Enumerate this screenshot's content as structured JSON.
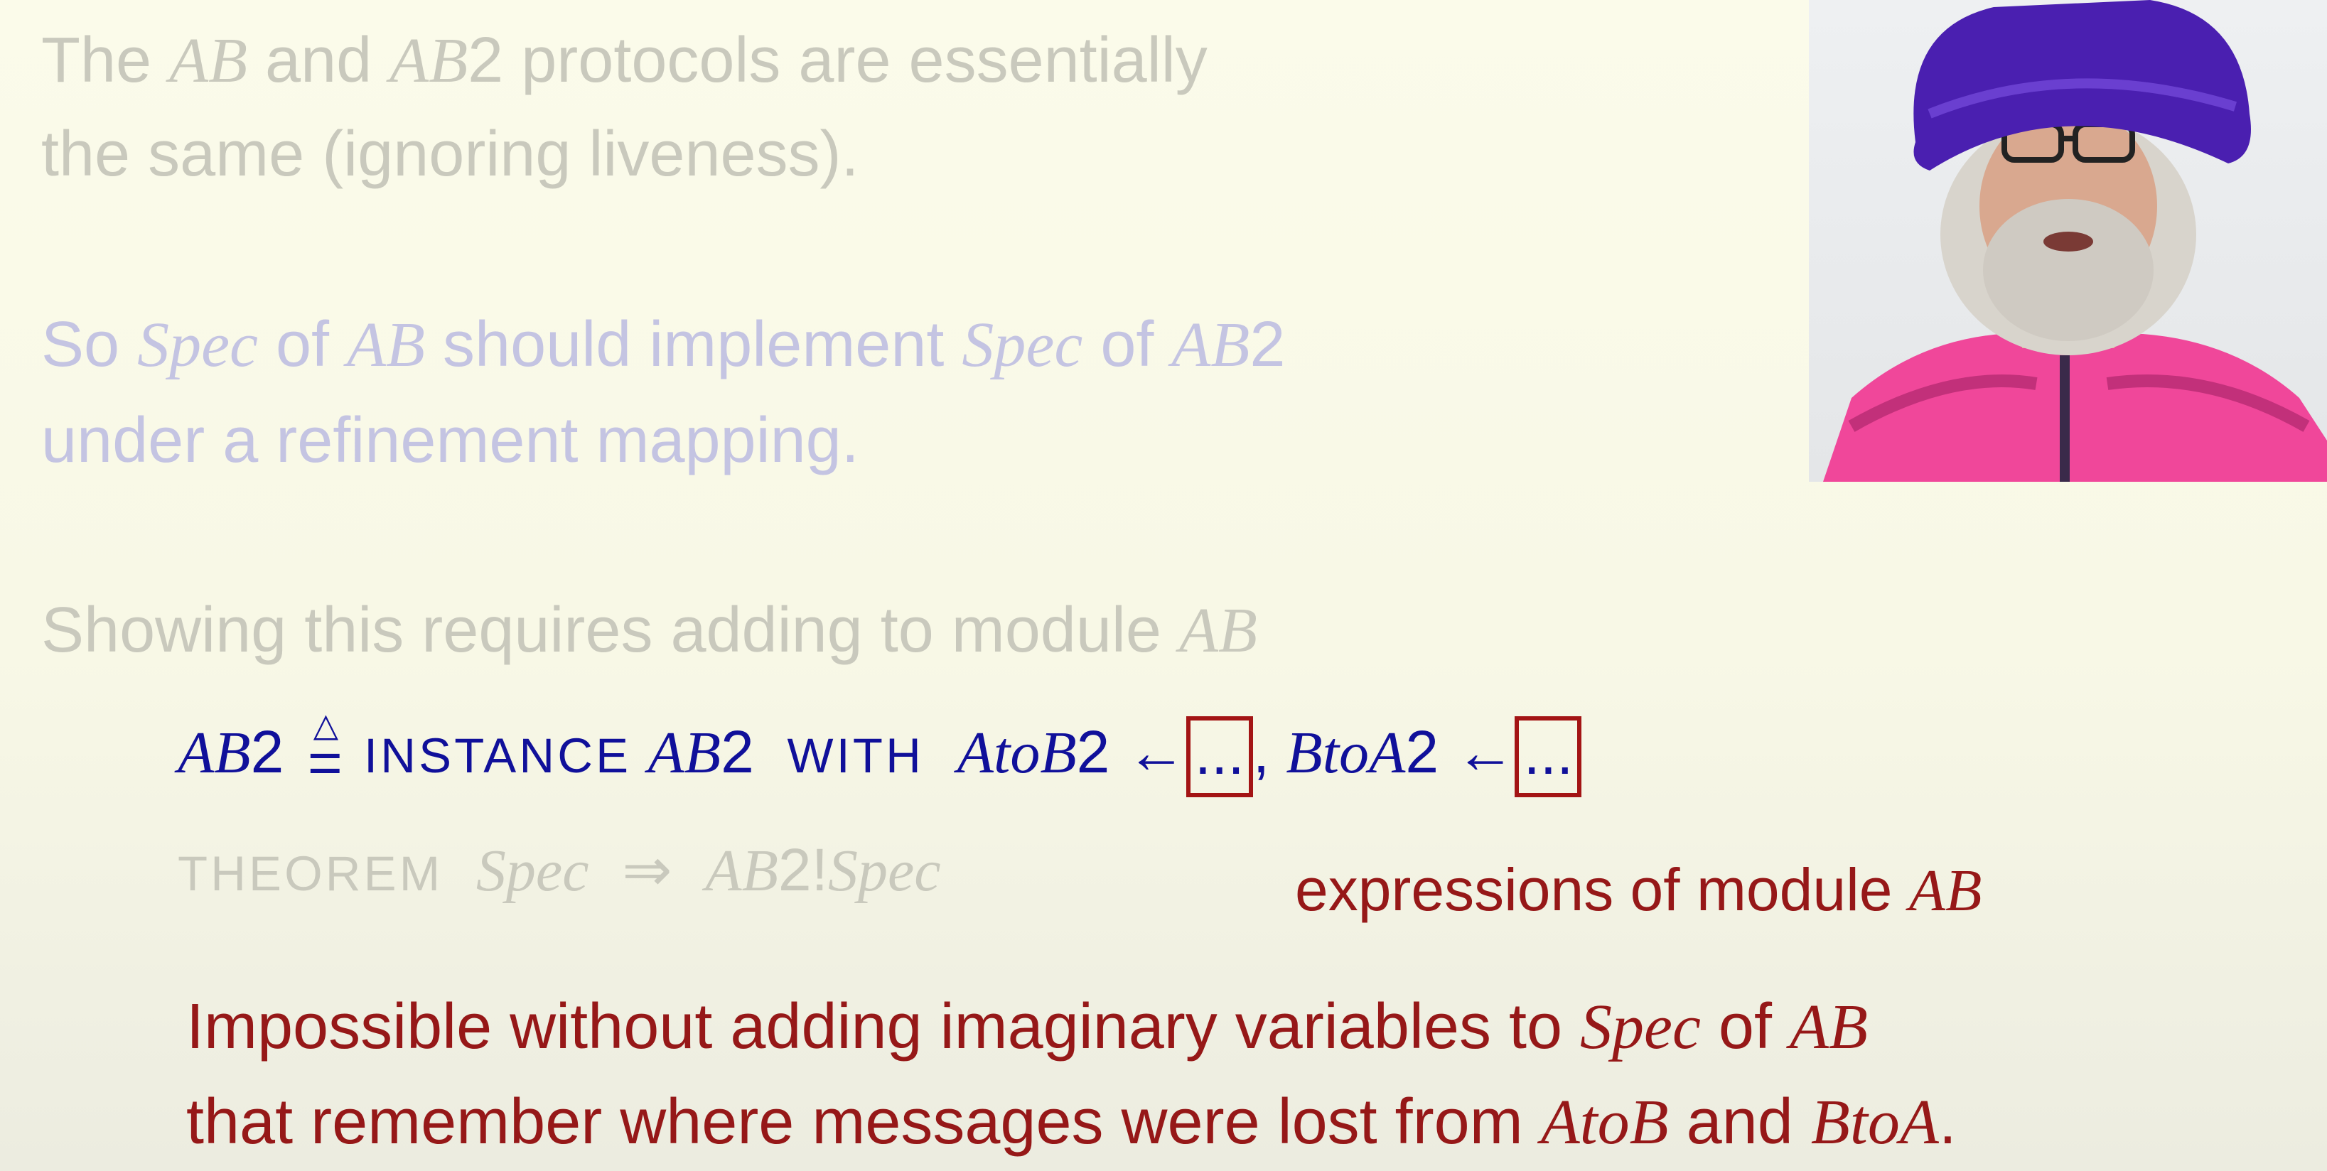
{
  "slide": {
    "line1": {
      "a": "The ",
      "b": "AB",
      "c": " and ",
      "d": "AB",
      "e": "2",
      "f": " protocols are essentially"
    },
    "line2": "the same (ignoring liveness).",
    "line3": {
      "a": "So ",
      "b": "Spec",
      "c": " of ",
      "d": "AB",
      "e": " should implement ",
      "f": "Spec",
      "g": " of ",
      "h": "AB",
      "i": "2"
    },
    "line4": "under a refinement mapping.",
    "line5": {
      "a": "Showing this requires adding to module ",
      "b": "AB"
    },
    "instance": {
      "lhs": "AB",
      "lhs2": "2",
      "kw_instance": "INSTANCE",
      "mod": "AB",
      "mod2": "2",
      "kw_with": "WITH",
      "v1": "AtoB",
      "v1n": "2",
      "arrow1": "←",
      "box1": "...",
      "comma": ",",
      "v2": "BtoA",
      "v2n": "2",
      "arrow2": "←",
      "box2": "..."
    },
    "theorem": {
      "kw": "THEOREM",
      "spec": "Spec",
      "implies": "⇒",
      "ab": "AB",
      "two": "2!",
      "spec2": "Spec"
    },
    "note": {
      "text": "expressions of module ",
      "ab": "AB"
    },
    "bottom1": {
      "a": "Impossible without adding imaginary variables to ",
      "b": "Spec",
      "c": " of ",
      "d": "AB"
    },
    "bottom2": {
      "a": "that remember where messages were lost from ",
      "b": "AtoB",
      "c": " and ",
      "d": "BtoA",
      "e": "."
    }
  },
  "video": {
    "name": "speaker-webcam"
  },
  "colors": {
    "faint_gray": "#c9c9bd",
    "faint_blue": "#c4c4e2",
    "blue": "#10109a",
    "red": "#961818",
    "hat": "#4a1fb0",
    "jacket": "#f0479a"
  }
}
